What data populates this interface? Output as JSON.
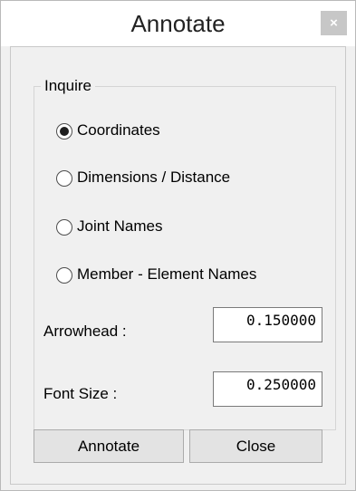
{
  "window": {
    "title": "Annotate",
    "close_glyph": "×"
  },
  "group": {
    "label": "Inquire"
  },
  "options": [
    {
      "label": "Coordinates",
      "selected": true
    },
    {
      "label": "Dimensions / Distance",
      "selected": false
    },
    {
      "label": "Joint Names",
      "selected": false
    },
    {
      "label": "Member - Element Names",
      "selected": false
    }
  ],
  "fields": {
    "arrowhead": {
      "label": "Arrowhead :",
      "value": "0.150000"
    },
    "font_size": {
      "label": "Font Size :",
      "value": "0.250000"
    }
  },
  "buttons": {
    "annotate": "Annotate",
    "close": "Close"
  }
}
